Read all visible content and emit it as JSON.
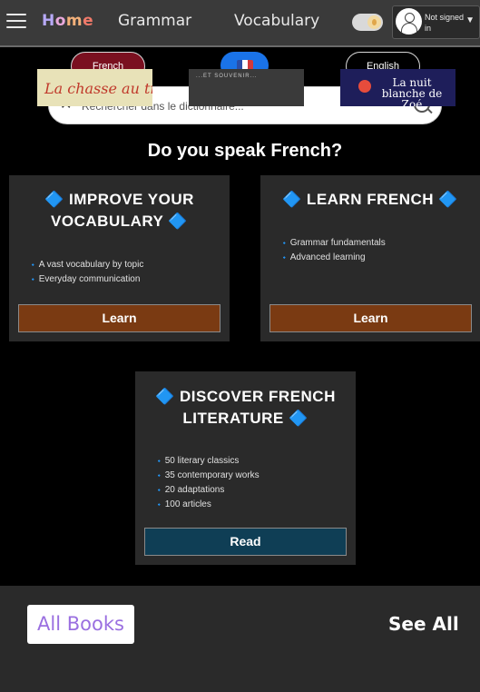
{
  "nav": {
    "logo": {
      "h": "H",
      "o": "o",
      "m": "m",
      "e": "e"
    },
    "grammar": "Grammar",
    "vocabulary": "Vocabulary",
    "user_status": "Not signed in",
    "caret": "▼"
  },
  "lang": {
    "source": "French",
    "target": "English"
  },
  "search": {
    "placeholder": "Rechercher dans le dictionnaire...",
    "clear": "✕"
  },
  "question": "Do you speak French?",
  "cards": {
    "vocab": {
      "title": "🔷 IMPROVE YOUR VOCABULARY 🔷",
      "items": [
        "A vast vocabulary by topic",
        "Everyday communication"
      ],
      "button": "Learn"
    },
    "learn": {
      "title": "🔷 LEARN FRENCH 🔷",
      "items": [
        "Grammar fundamentals",
        "Advanced learning"
      ],
      "button": "Learn"
    },
    "literature": {
      "title": "🔷 DISCOVER FRENCH LITERATURE 🔷",
      "items": [
        "50 literary classics",
        "35 contemporary works",
        "20 adaptations",
        "100 articles"
      ],
      "button": "Read"
    }
  },
  "books": {
    "heading": "All Books",
    "see_all": "See All",
    "items": [
      {
        "title": "La chasse au trésor"
      },
      {
        "title": "...ET SOUVENIR..."
      },
      {
        "title": "La nuit blanche de Zoé"
      }
    ]
  },
  "colors": {
    "accent_brown": "#7a3a12",
    "accent_teal": "#0f3e55",
    "french_button": "#7a1020",
    "flag_button": "#1a73e8"
  }
}
